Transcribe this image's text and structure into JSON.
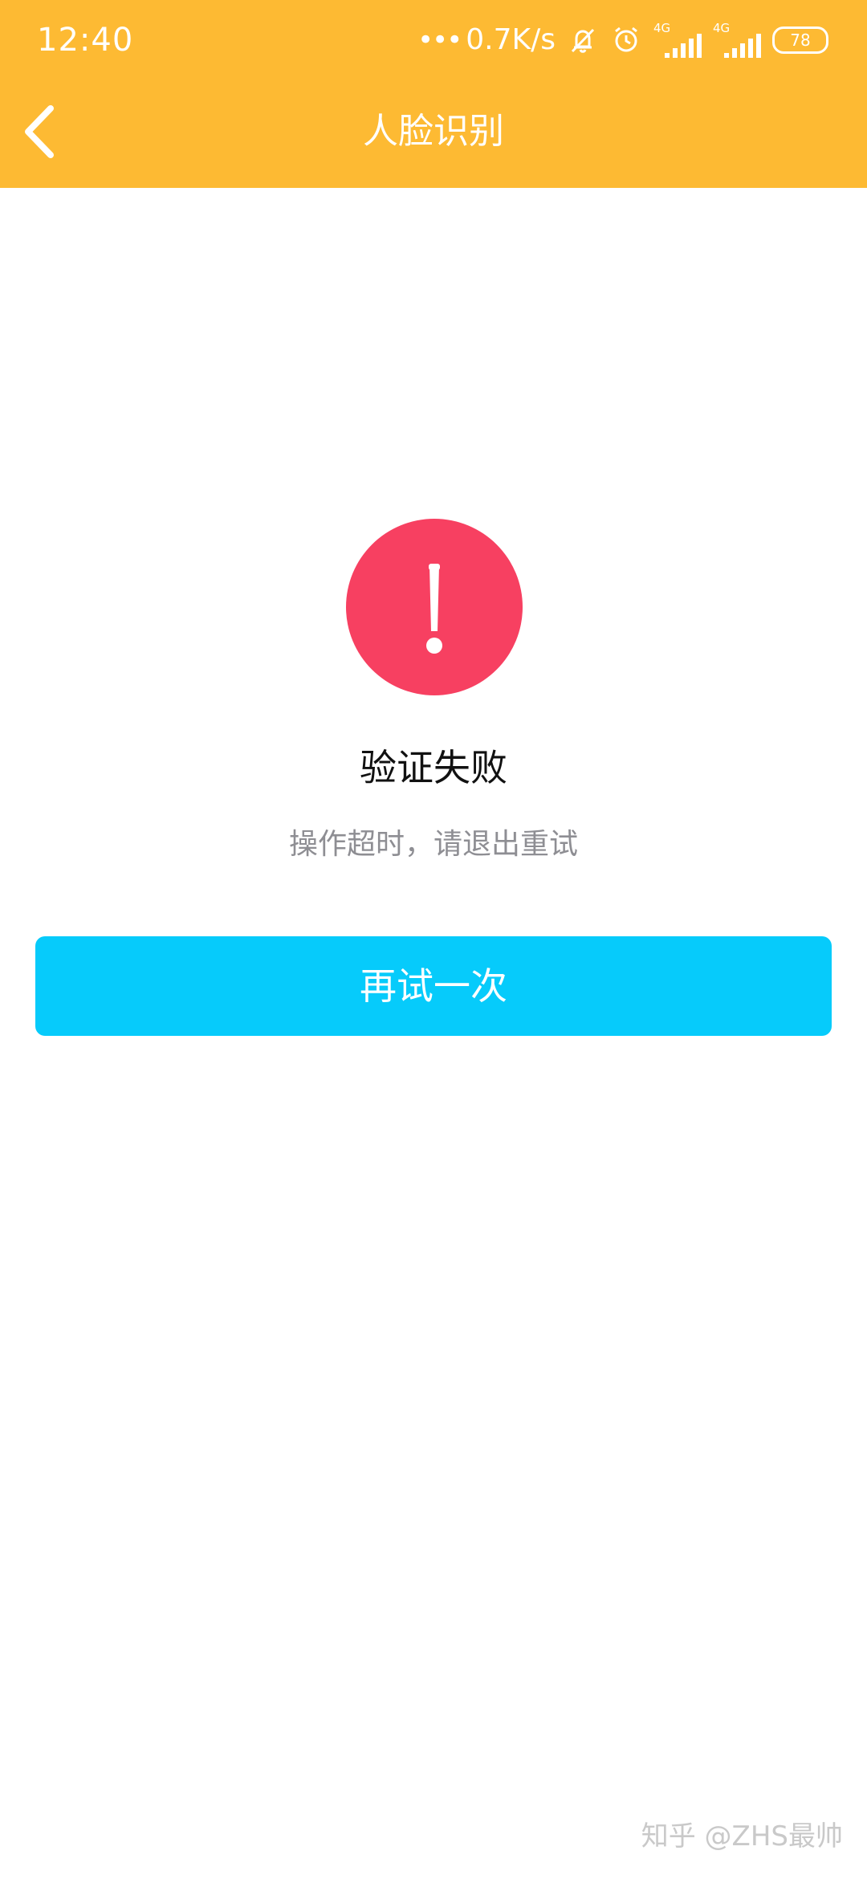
{
  "status_bar": {
    "time": "12:40",
    "net_dots": "•••",
    "net_speed": "0.7K/s",
    "signal_1_tag": "4G",
    "signal_2_tag": "4G",
    "battery": "78",
    "icons": [
      "mute-bell-icon",
      "alarm-clock-icon",
      "signal-icon",
      "signal-icon",
      "battery-icon"
    ]
  },
  "header": {
    "title": "人脸识别",
    "back_icon": "chevron-left-icon",
    "background_color": "#FDBA33"
  },
  "result": {
    "icon": "exclamation-icon",
    "icon_color": "#F74061",
    "title": "验证失败",
    "message": "操作超时，请退出重试"
  },
  "actions": {
    "retry_label": "再试一次",
    "retry_color": "#06CBFB"
  },
  "watermark": {
    "text": "知乎 @ZHS最帅"
  }
}
